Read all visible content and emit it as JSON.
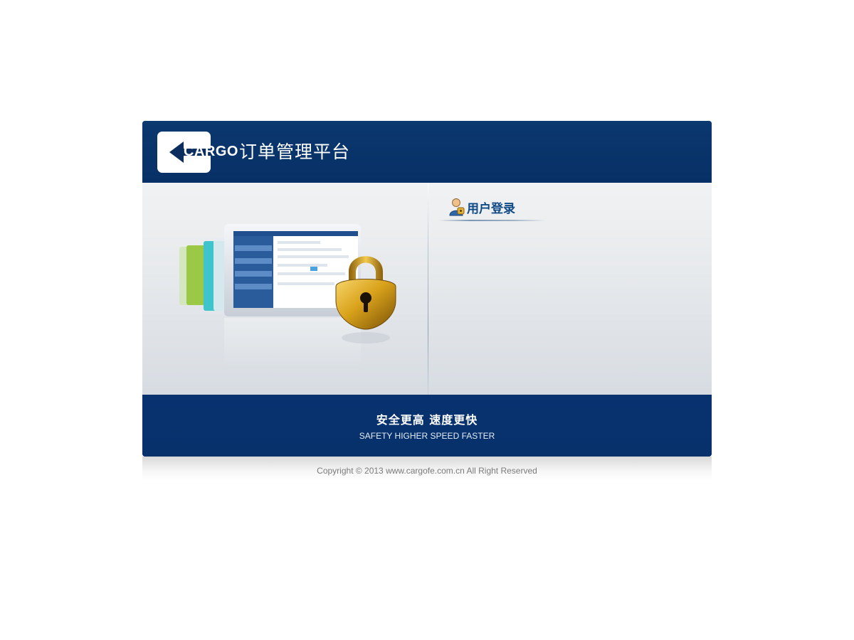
{
  "header": {
    "logo_text": "CARGO",
    "platform_title": "订单管理平台"
  },
  "login": {
    "title": "用户登录"
  },
  "footer": {
    "slogan_cn": "安全更高 速度更快",
    "slogan_en": "SAFETY HIGHER SPEED FASTER"
  },
  "copyright": "Copyright © 2013 www.cargofe.com.cn All Right Reserved",
  "icons": {
    "logo": "cargo-arrow-logo",
    "login": "user-icon",
    "illustration": "padlock-icon"
  },
  "colors": {
    "brand_navy": "#06316a",
    "title_blue": "#0f4a86",
    "lock_gold": "#d9a21b"
  }
}
